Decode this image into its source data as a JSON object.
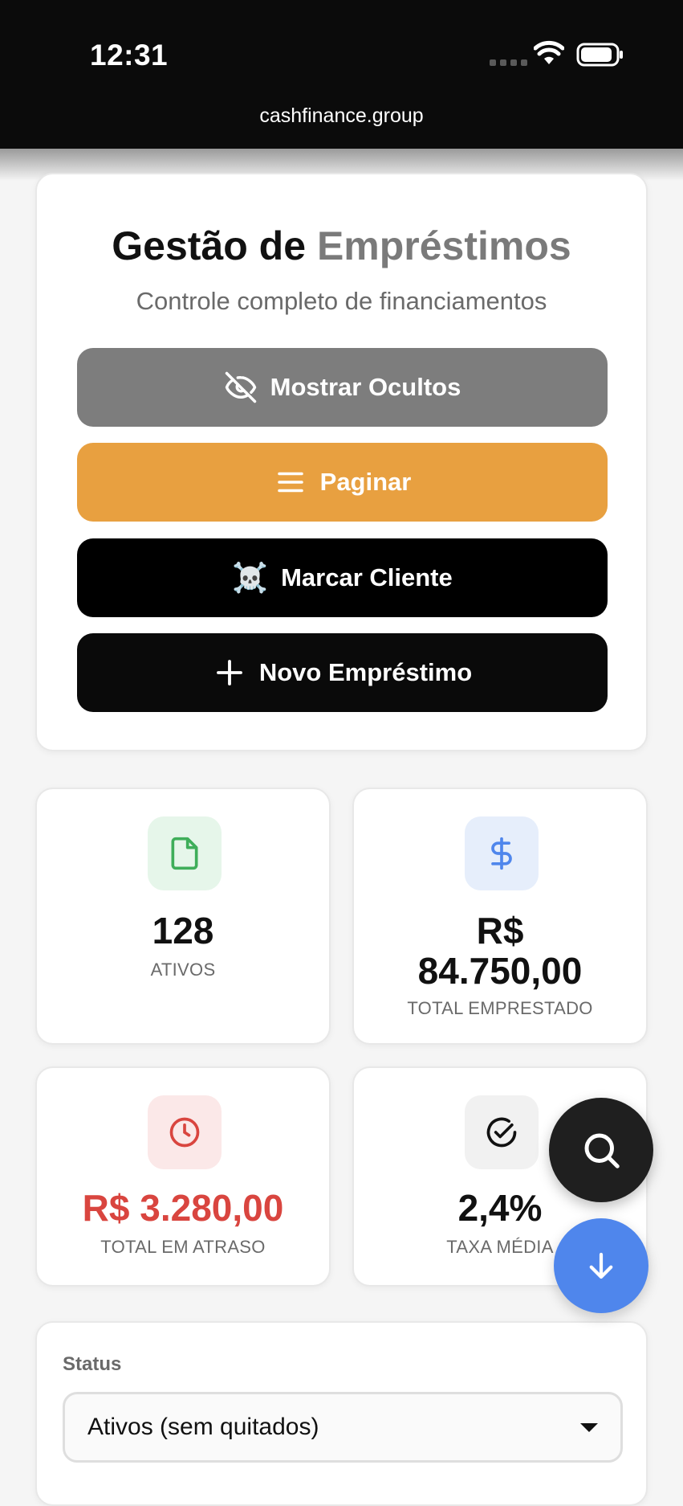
{
  "status_bar": {
    "time": "12:31",
    "url": "cashfinance.group"
  },
  "hero": {
    "title_main": "Gestão de",
    "title_accent": "Empréstimos",
    "subtitle": "Controle completo de financiamentos",
    "buttons": {
      "show_hidden": "Mostrar Ocultos",
      "paginate": "Paginar",
      "mark_client": "Marcar Cliente",
      "mark_client_emoji": "☠️",
      "new_loan": "Novo Empréstimo"
    }
  },
  "stats": [
    {
      "value": "128",
      "label": "ATIVOS",
      "icon": "file-icon",
      "icon_color": "#3fae5a",
      "bg": "#e6f6ea"
    },
    {
      "value_line1": "R$",
      "value_line2": "84.750,00",
      "label": "TOTAL EMPRESTADO",
      "icon": "dollar-icon",
      "icon_color": "#4f86ec",
      "bg": "#e6eefb"
    },
    {
      "value": "R$ 3.280,00",
      "label": "TOTAL EM ATRASO",
      "icon": "clock-icon",
      "icon_color": "#d9453f",
      "value_color": "#d9453f",
      "bg": "#fbe8e8"
    },
    {
      "value": "2,4%",
      "label": "TAXA MÉDIA",
      "icon": "check-circle-icon",
      "icon_color": "#111111",
      "bg": "#f1f1f1"
    }
  ],
  "filter": {
    "label": "Status",
    "selected": "Ativos (sem quitados)"
  },
  "colors": {
    "accent_orange": "#e8a040",
    "accent_blue": "#4f86ec",
    "danger_red": "#d9453f"
  }
}
